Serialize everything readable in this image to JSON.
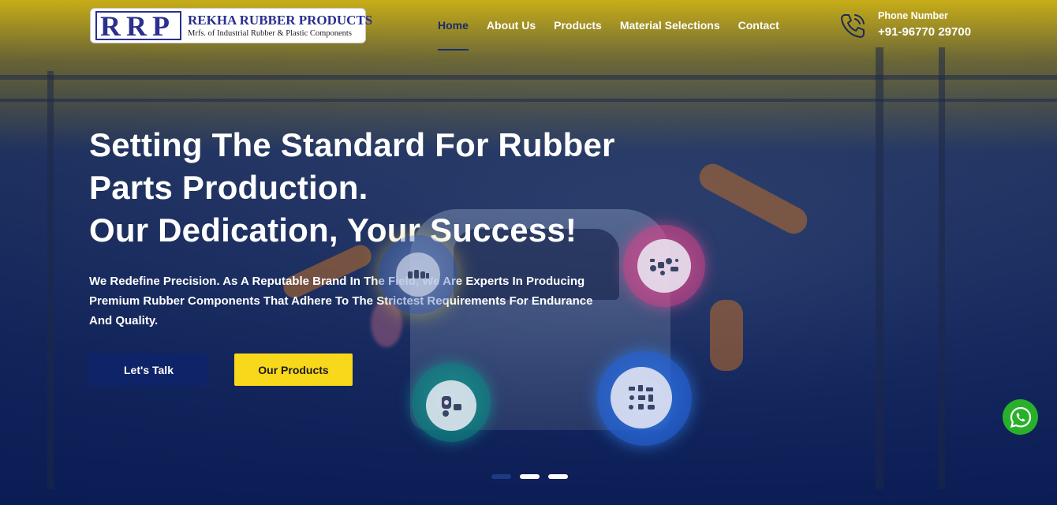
{
  "brand": {
    "mark": "RRP",
    "name": "REKHA RUBBER PRODUCTS",
    "tagline": "Mrfs. of Industrial Rubber & Plastic Components"
  },
  "nav": {
    "items": [
      {
        "label": "Home",
        "active": true
      },
      {
        "label": "About Us",
        "active": false
      },
      {
        "label": "Products",
        "active": false
      },
      {
        "label": "Material Selections",
        "active": false
      },
      {
        "label": "Contact",
        "active": false
      }
    ]
  },
  "contact": {
    "label": "Phone Number",
    "number": "+91-96770 29700",
    "icon": "phone-icon"
  },
  "hero": {
    "headline_lines": [
      "Setting The Standard For Rubber",
      "Parts Production.",
      "Our Dedication, Your Success!"
    ],
    "lead": "We Redefine Precision. As A Reputable Brand In The Field, We Are Experts In Producing Premium Rubber Components That Adhere To The Strictest Requirements For Endurance And Quality.",
    "buttons": {
      "talk": "Let's Talk",
      "products": "Our Products"
    }
  },
  "slider": {
    "count": 3,
    "active_index": 0
  },
  "colors": {
    "accent_yellow": "#f8d81b",
    "navy": "#0f2468",
    "whatsapp_green": "#29b02b"
  },
  "floating": {
    "icon": "whatsapp-icon"
  }
}
